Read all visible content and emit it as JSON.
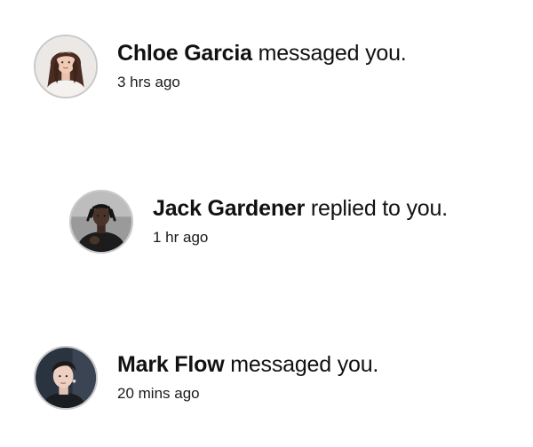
{
  "notifications": [
    {
      "name": "Chloe Garcia",
      "action": "messaged you.",
      "time": "3 hrs ago",
      "avatar_icon": "user-avatar-chloe"
    },
    {
      "name": "Jack Gardener",
      "action": "replied to you.",
      "time": "1 hr ago",
      "avatar_icon": "user-avatar-jack"
    },
    {
      "name": "Mark Flow",
      "action": "messaged you.",
      "time": "20 mins ago",
      "avatar_icon": "user-avatar-mark"
    }
  ],
  "colors": {
    "background": "#ffffff",
    "text": "#111111",
    "avatar_border": "#c9c9c9"
  }
}
